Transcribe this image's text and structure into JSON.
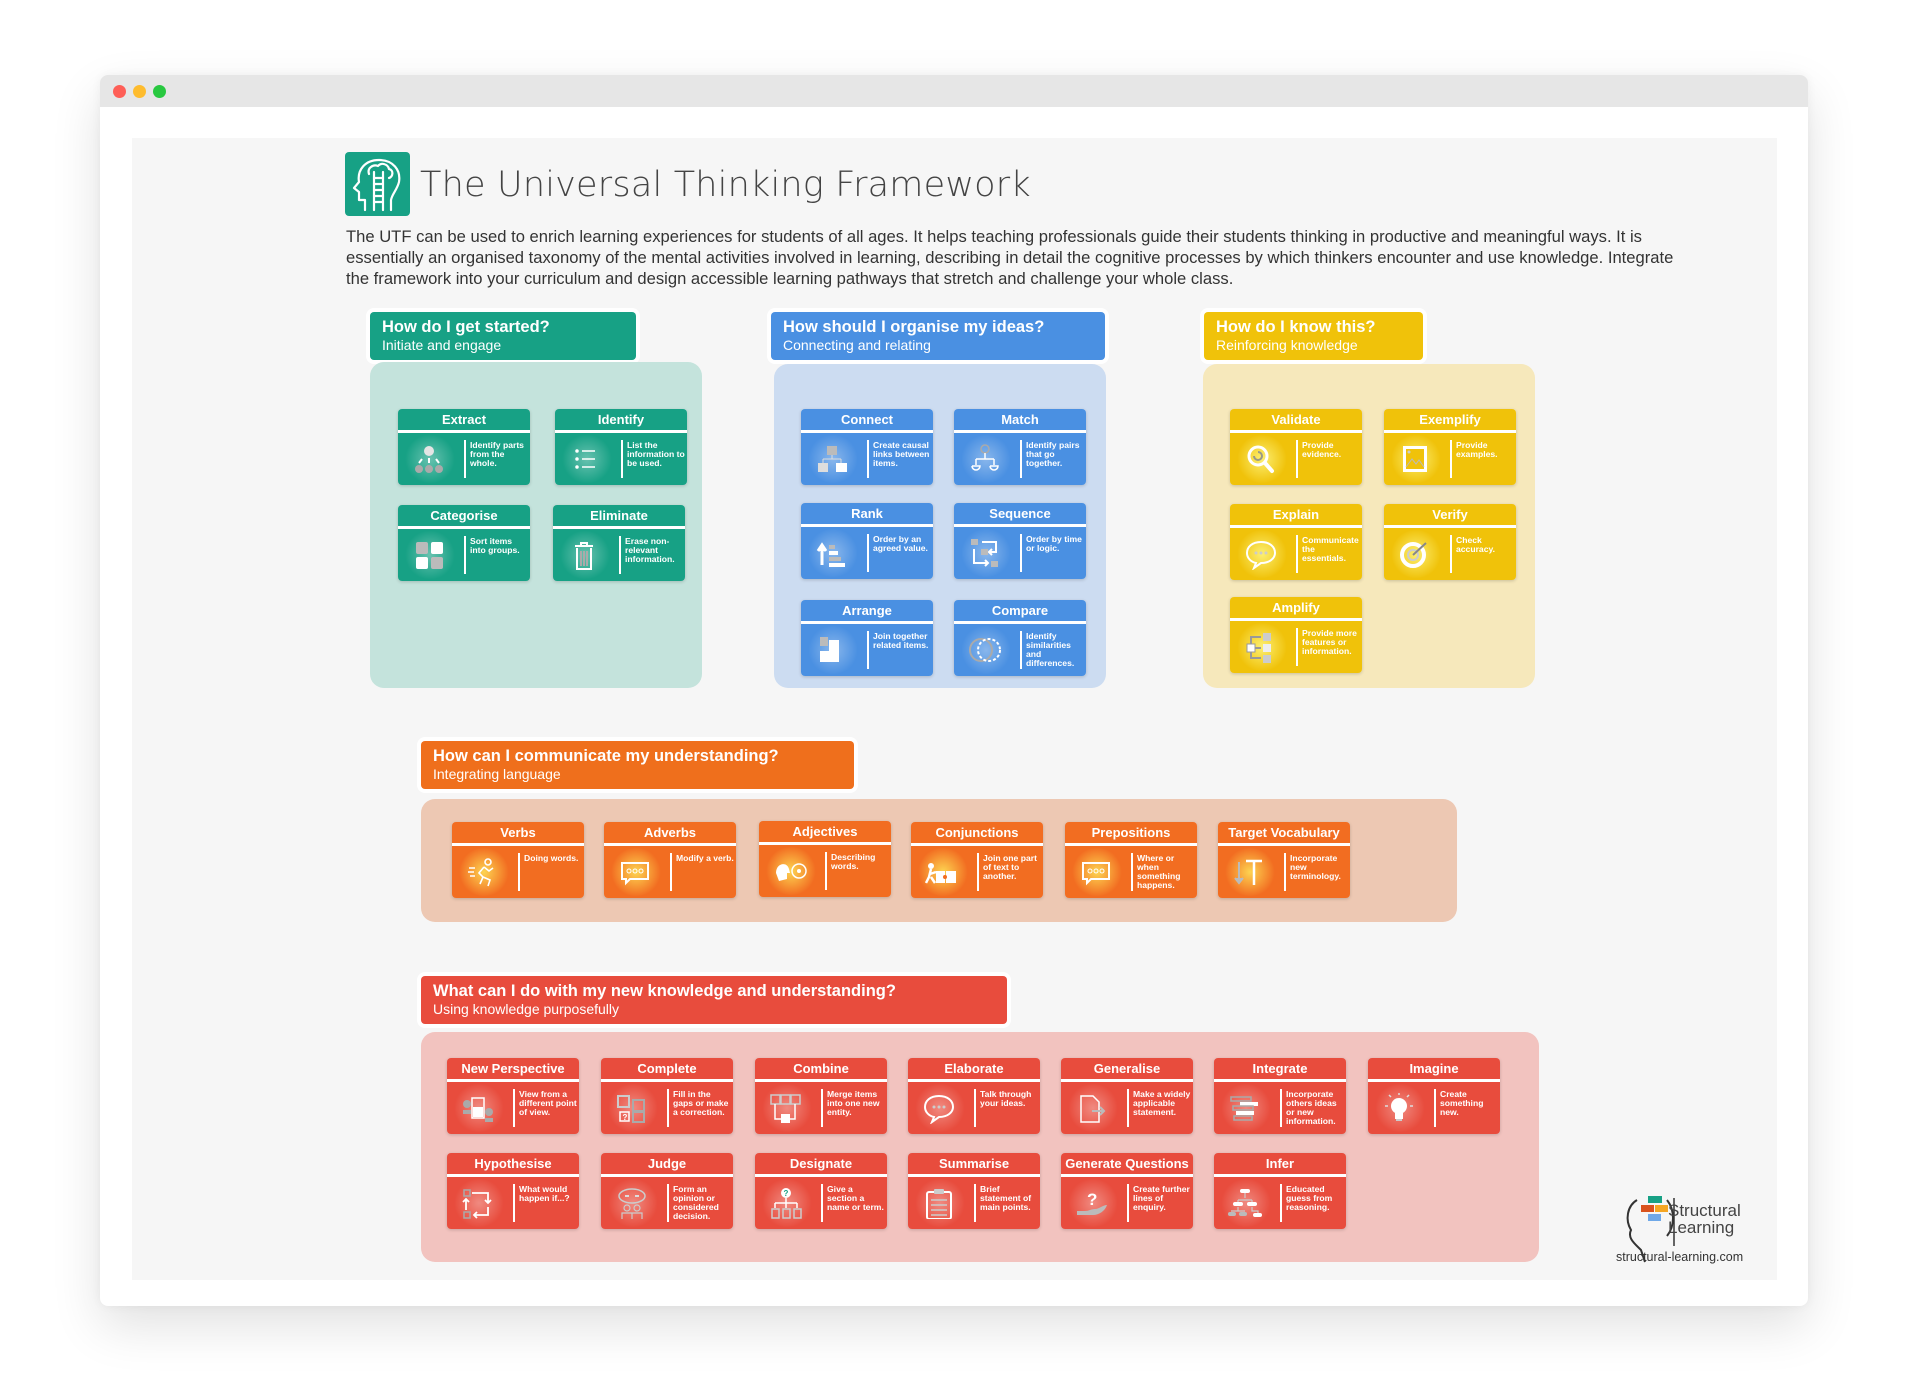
{
  "window": {
    "controls": [
      "close",
      "minimize",
      "maximize"
    ]
  },
  "header": {
    "logo_icon": "head-ladder-icon",
    "title": "The Universal Thinking Framework",
    "intro": "The UTF can be used to enrich learning experiences for students of all ages. It helps teaching professionals guide their students thinking in productive and meaningful ways. It is essentially an organised taxonomy of the mental activities involved in learning, describing in detail the cognitive processes by which thinkers encounter and use knowledge. Integrate the framework into your curriculum and design accessible learning pathways that stretch and challenge your whole class."
  },
  "colors": {
    "teal": "#17a185",
    "teal_bg": "#c4e3dc",
    "blue": "#4a90e2",
    "blue_bg": "#ccdcf1",
    "yellow": "#f0c20a",
    "yellow_bg": "#f6e8bb",
    "orange": "#f26d21",
    "orange_bg": "#edc8b3",
    "red": "#e84c3d",
    "red_bg": "#f2c3bf"
  },
  "sections": [
    {
      "question": "How do I get started?",
      "subtitle": "Initiate and engage",
      "cards": [
        {
          "name": "Extract",
          "desc": "Identify parts from the whole.",
          "icon": "hierarchy-extract-icon"
        },
        {
          "name": "Identify",
          "desc": "List the information to be used.",
          "icon": "bullet-list-icon"
        },
        {
          "name": "Categorise",
          "desc": "Sort items into groups.",
          "icon": "grid-squares-icon"
        },
        {
          "name": "Eliminate",
          "desc": "Erase non-relevant information.",
          "icon": "trash-icon"
        }
      ]
    },
    {
      "question": "How should I organise my ideas?",
      "subtitle": "Connecting and relating",
      "cards": [
        {
          "name": "Connect",
          "desc": "Create causal links between items.",
          "icon": "connect-boxes-icon"
        },
        {
          "name": "Match",
          "desc": "Identify pairs that go together.",
          "icon": "scales-icon"
        },
        {
          "name": "Rank",
          "desc": "Order by an agreed value.",
          "icon": "rank-bars-icon"
        },
        {
          "name": "Sequence",
          "desc": "Order by time or logic.",
          "icon": "sequence-arrows-icon"
        },
        {
          "name": "Arrange",
          "desc": "Join together related items.",
          "icon": "arrange-blocks-icon"
        },
        {
          "name": "Compare",
          "desc": "Identify similarities and differences.",
          "icon": "venn-circles-icon"
        }
      ]
    },
    {
      "question": "How do I know this?",
      "subtitle": "Reinforcing knowledge",
      "cards": [
        {
          "name": "Validate",
          "desc": "Provide evidence.",
          "icon": "magnifier-icon"
        },
        {
          "name": "Exemplify",
          "desc": "Provide examples.",
          "icon": "picture-icon"
        },
        {
          "name": "Explain",
          "desc": "Communicate the essentials.",
          "icon": "speech-bubble-icon"
        },
        {
          "name": "Verify",
          "desc": "Check accuracy.",
          "icon": "target-icon"
        },
        {
          "name": "Amplify",
          "desc": "Provide more features or information.",
          "icon": "branch-diagram-icon"
        }
      ]
    },
    {
      "question": "How can I communicate my understanding?",
      "subtitle": "Integrating language",
      "cards": [
        {
          "name": "Verbs",
          "desc": "Doing words.",
          "icon": "running-person-icon"
        },
        {
          "name": "Adverbs",
          "desc": "Modify a verb.",
          "icon": "chat-dots-icon"
        },
        {
          "name": "Adjectives",
          "desc": "Describing words.",
          "icon": "head-eye-icon"
        },
        {
          "name": "Conjunctions",
          "desc": "Join one part of text to another.",
          "icon": "puzzle-push-icon"
        },
        {
          "name": "Prepositions",
          "desc": "Where or when something happens.",
          "icon": "chat-dots-icon"
        },
        {
          "name": "Target Vocabulary",
          "desc": "Incorporate new terminology.",
          "icon": "text-t-icon"
        }
      ]
    },
    {
      "question": "What can I do with my new knowledge and understanding?",
      "subtitle": "Using knowledge purposefully",
      "cards": [
        {
          "name": "New Perspective",
          "desc": "View from a different point of view.",
          "icon": "glass-heads-icon"
        },
        {
          "name": "Complete",
          "desc": "Fill in the gaps or make a correction.",
          "icon": "question-grid-icon"
        },
        {
          "name": "Combine",
          "desc": "Merge items into one new entity.",
          "icon": "merge-boxes-icon"
        },
        {
          "name": "Elaborate",
          "desc": "Talk through your ideas.",
          "icon": "speech-bubble-icon"
        },
        {
          "name": "Generalise",
          "desc": "Make a widely applicable statement.",
          "icon": "document-arrow-icon"
        },
        {
          "name": "Integrate",
          "desc": "Incorporate others ideas or new information.",
          "icon": "stacked-bars-icon"
        },
        {
          "name": "Imagine",
          "desc": "Create something new.",
          "icon": "lightbulb-icon"
        },
        {
          "name": "Hypothesise",
          "desc": "What would happen if...?",
          "icon": "cycle-arrows-icon"
        },
        {
          "name": "Judge",
          "desc": "Form an opinion or considered decision.",
          "icon": "thumbs-people-icon"
        },
        {
          "name": "Designate",
          "desc": "Give a section a name or term.",
          "icon": "question-tree-icon"
        },
        {
          "name": "Summarise",
          "desc": "Brief statement of main points.",
          "icon": "clipboard-icon"
        },
        {
          "name": "Generate Questions",
          "desc": "Create further lines of enquiry.",
          "icon": "hand-question-icon"
        },
        {
          "name": "Infer",
          "desc": "Educated guess from reasoning.",
          "icon": "flowchart-icon"
        }
      ]
    }
  ],
  "branding": {
    "name_line1": "Structural",
    "name_line2": "Learning",
    "url": "structural-learning.com"
  }
}
